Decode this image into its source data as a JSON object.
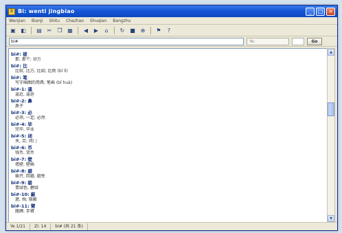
{
  "window": {
    "title": "Bi: wenti jingbiao",
    "icon_label": "B"
  },
  "menu": [
    "Wenjian",
    "Bianji",
    "Shitu",
    "Chazhao",
    "Shuqian",
    "Bangzhu"
  ],
  "toolbar": {
    "icons": [
      "open-folder-icon",
      "save-icon",
      "print-icon",
      "cut-icon",
      "copy-icon",
      "paste-icon",
      "back-icon",
      "forward-icon",
      "home-icon",
      "refresh-icon",
      "stop-icon",
      "zoom-icon",
      "bookmark-icon",
      "help-icon"
    ]
  },
  "search": {
    "value": "bi#",
    "page_placeholder": "Ye:",
    "go_label": "Go"
  },
  "entries": [
    {
      "title": "bi#: 彼",
      "body": "那, 那个; 对方"
    },
    {
      "title": "bi#: 比",
      "body": "比较, 比方, 比如; 比例 (bǐ lì)"
    },
    {
      "title": "bi#: 笔",
      "body": "写字画图的用具; 笔画 (bǐ huà)"
    },
    {
      "title": "bi#-1: 逼",
      "body": "逼近, 逼迫"
    },
    {
      "title": "bi#-2: 鼻",
      "body": "鼻子"
    },
    {
      "title": "bi#-3: 必",
      "body": "必须, 一定; 必然"
    },
    {
      "title": "bi#-4: 毕",
      "body": "完毕, 毕业"
    },
    {
      "title": "bi#-5: 闭",
      "body": "关, 合; 闭门"
    },
    {
      "title": "bi#-6: 币",
      "body": "钱币, 货币"
    },
    {
      "title": "bi#-7: 壁",
      "body": "墙壁, 壁画"
    },
    {
      "title": "bi#-8: 避",
      "body": "躲开, 回避, 避免"
    },
    {
      "title": "bi#-9: 碧",
      "body": "青绿色, 碧绿"
    },
    {
      "title": "bi#-10: 蔽",
      "body": "遮, 挡; 隐蔽"
    },
    {
      "title": "bi#-11: 臂",
      "body": "胳膊, 手臂"
    }
  ],
  "statusbar": [
    "Ye 1/21",
    "Zi: 14",
    "bi# (共 21 条)"
  ],
  "colors": {
    "titlebar": "#1557d6",
    "entry_title": "#0b2a7a"
  }
}
